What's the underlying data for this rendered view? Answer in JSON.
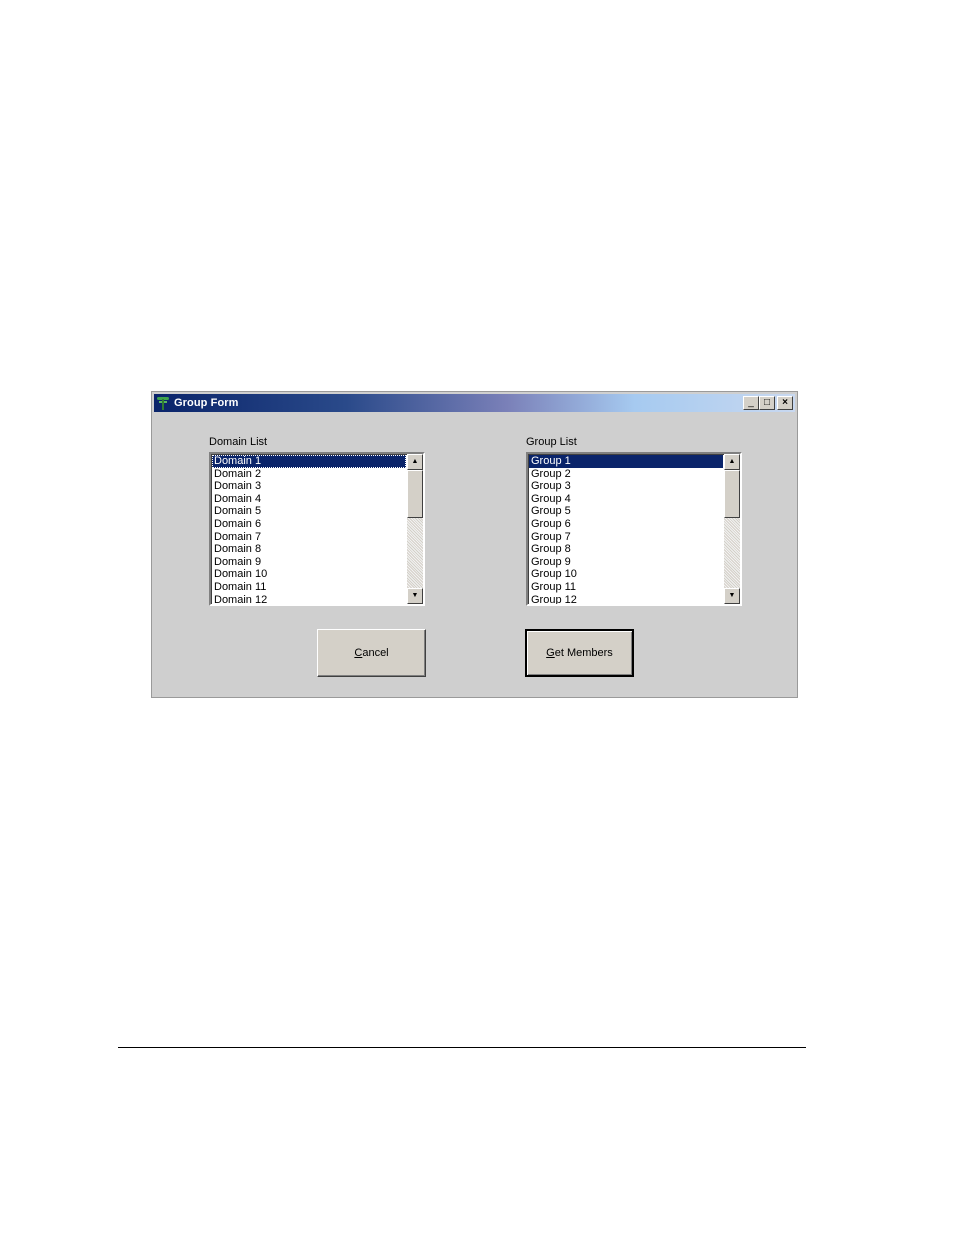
{
  "window": {
    "title": "Group Form",
    "title_buttons": {
      "minimize": "_",
      "maximize": "□",
      "close": "×"
    }
  },
  "domain_list": {
    "label": "Domain List",
    "items": [
      "Domain 1",
      "Domain 2",
      "Domain 3",
      "Domain 4",
      "Domain 5",
      "Domain 6",
      "Domain 7",
      "Domain 8",
      "Domain 9",
      "Domain 10",
      "Domain 11",
      "Domain 12"
    ],
    "selected_index": 0
  },
  "group_list": {
    "label": "Group List",
    "items": [
      "Group 1",
      "Group 2",
      "Group 3",
      "Group 4",
      "Group 5",
      "Group 6",
      "Group 7",
      "Group 8",
      "Group 9",
      "Group 10",
      "Group 11",
      "Group 12"
    ],
    "selected_index": 0
  },
  "buttons": {
    "cancel": {
      "accel": "C",
      "rest": "ancel"
    },
    "get_members": {
      "accel": "G",
      "rest": "et Members"
    }
  },
  "scroll_arrows": {
    "up": "▲",
    "down": "▼"
  },
  "colors": {
    "selection": "#0a246a",
    "window_bg": "#cfcfcf",
    "title_start": "#0a246a",
    "title_end": "#c8d8f0"
  }
}
